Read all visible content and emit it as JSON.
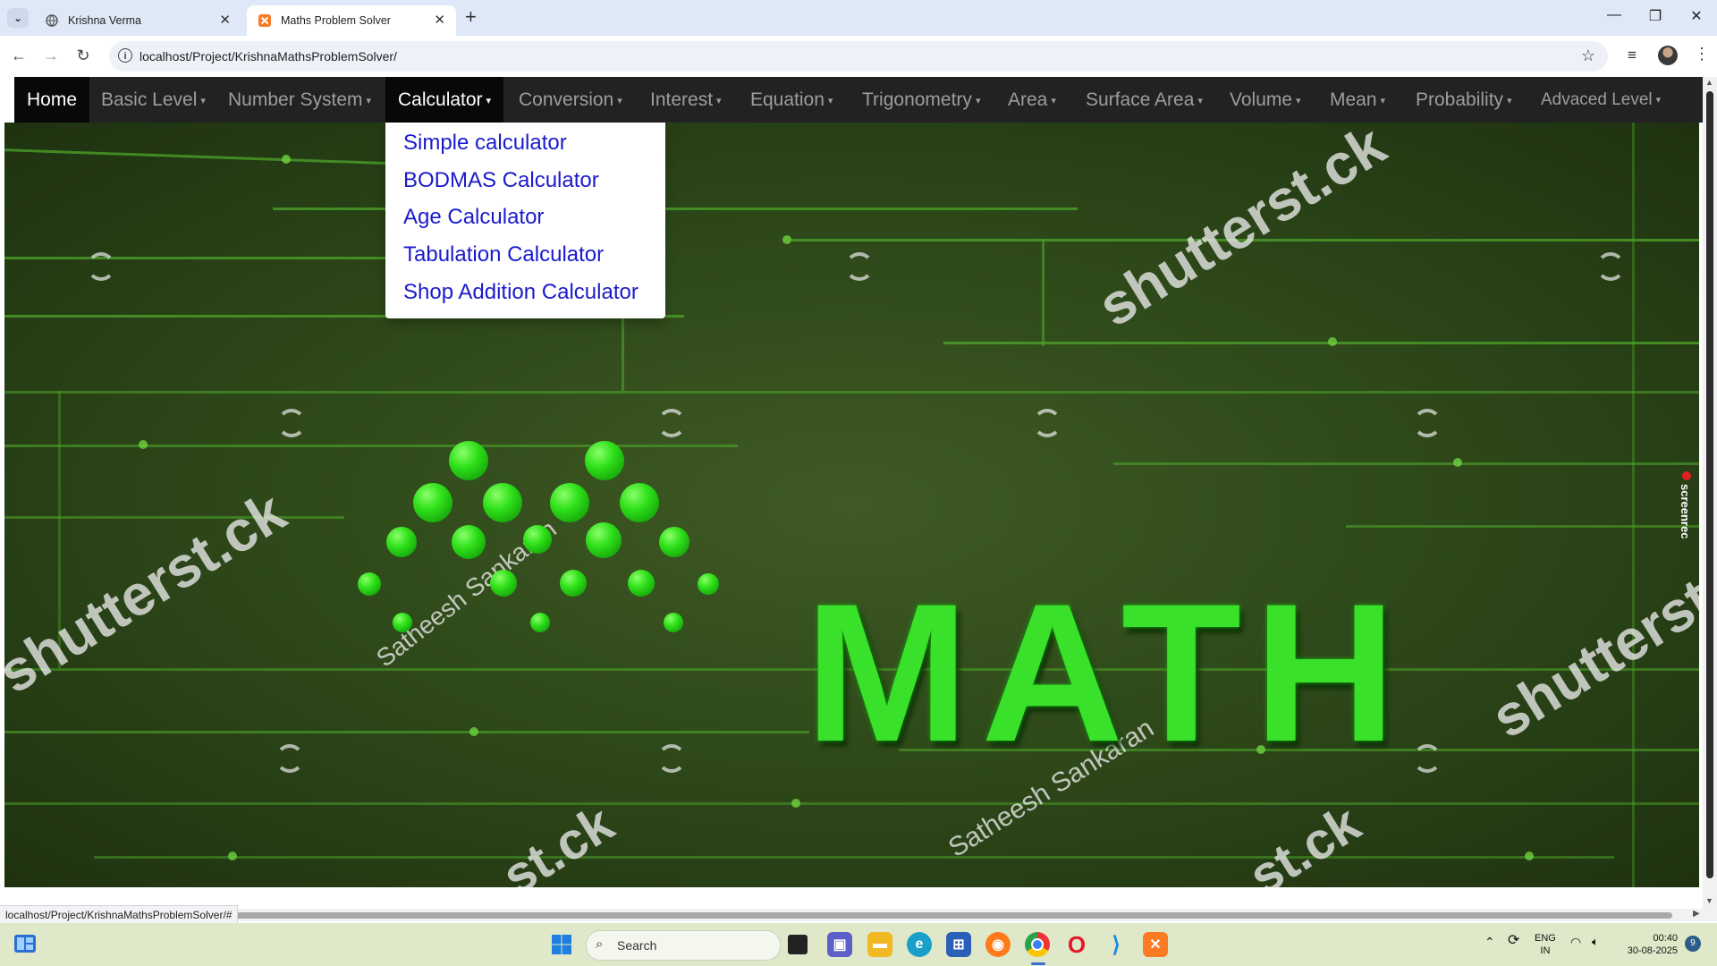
{
  "browser": {
    "tabs": [
      {
        "title": "Krishna Verma",
        "active": false
      },
      {
        "title": "Maths Problem Solver",
        "active": true
      }
    ],
    "url": "localhost/Project/KrishnaMathsProblemSolver/",
    "status_url": "localhost/Project/KrishnaMathsProblemSolver/#"
  },
  "navbar": {
    "items": [
      {
        "label": "Home",
        "state": "active"
      },
      {
        "label": "Basic Level",
        "caret": true
      },
      {
        "label": "Number System",
        "caret": true
      },
      {
        "label": "Calculator",
        "caret": true,
        "state": "open"
      },
      {
        "label": "Conversion",
        "caret": true
      },
      {
        "label": "Interest",
        "caret": true
      },
      {
        "label": "Equation",
        "caret": true
      },
      {
        "label": "Trigonometry",
        "caret": true
      },
      {
        "label": "Area",
        "caret": true
      },
      {
        "label": "Surface Area",
        "caret": true
      },
      {
        "label": "Volume",
        "caret": true
      },
      {
        "label": "Mean",
        "caret": true
      },
      {
        "label": "Probability",
        "caret": true
      },
      {
        "label": "Advaced Level",
        "caret": true
      }
    ]
  },
  "dropdown": {
    "items": [
      "Simple calculator",
      "BODMAS Calculator",
      "Age Calculator",
      "Tabulation Calculator",
      "Shop Addition Calculator"
    ]
  },
  "hero": {
    "title": "MATH",
    "watermarks": [
      "shutterst.ck",
      "shutterst.ck",
      "shutterst.ck",
      "st.ck",
      "st.ck"
    ],
    "credits": [
      "Satheesh Sankaran",
      "Satheesh Sankaran"
    ],
    "side_badge": "screenrec"
  },
  "taskbar": {
    "search_placeholder": "Search",
    "lang_top": "ENG",
    "lang_bottom": "IN",
    "time": "00:40",
    "date": "30-08-2025",
    "notification_count": "9"
  },
  "colors": {
    "navbar_bg": "#222222",
    "dropdown_link": "#1a1acc",
    "math_green": "#39e12a",
    "hero_bg": "#2f4a1a"
  }
}
